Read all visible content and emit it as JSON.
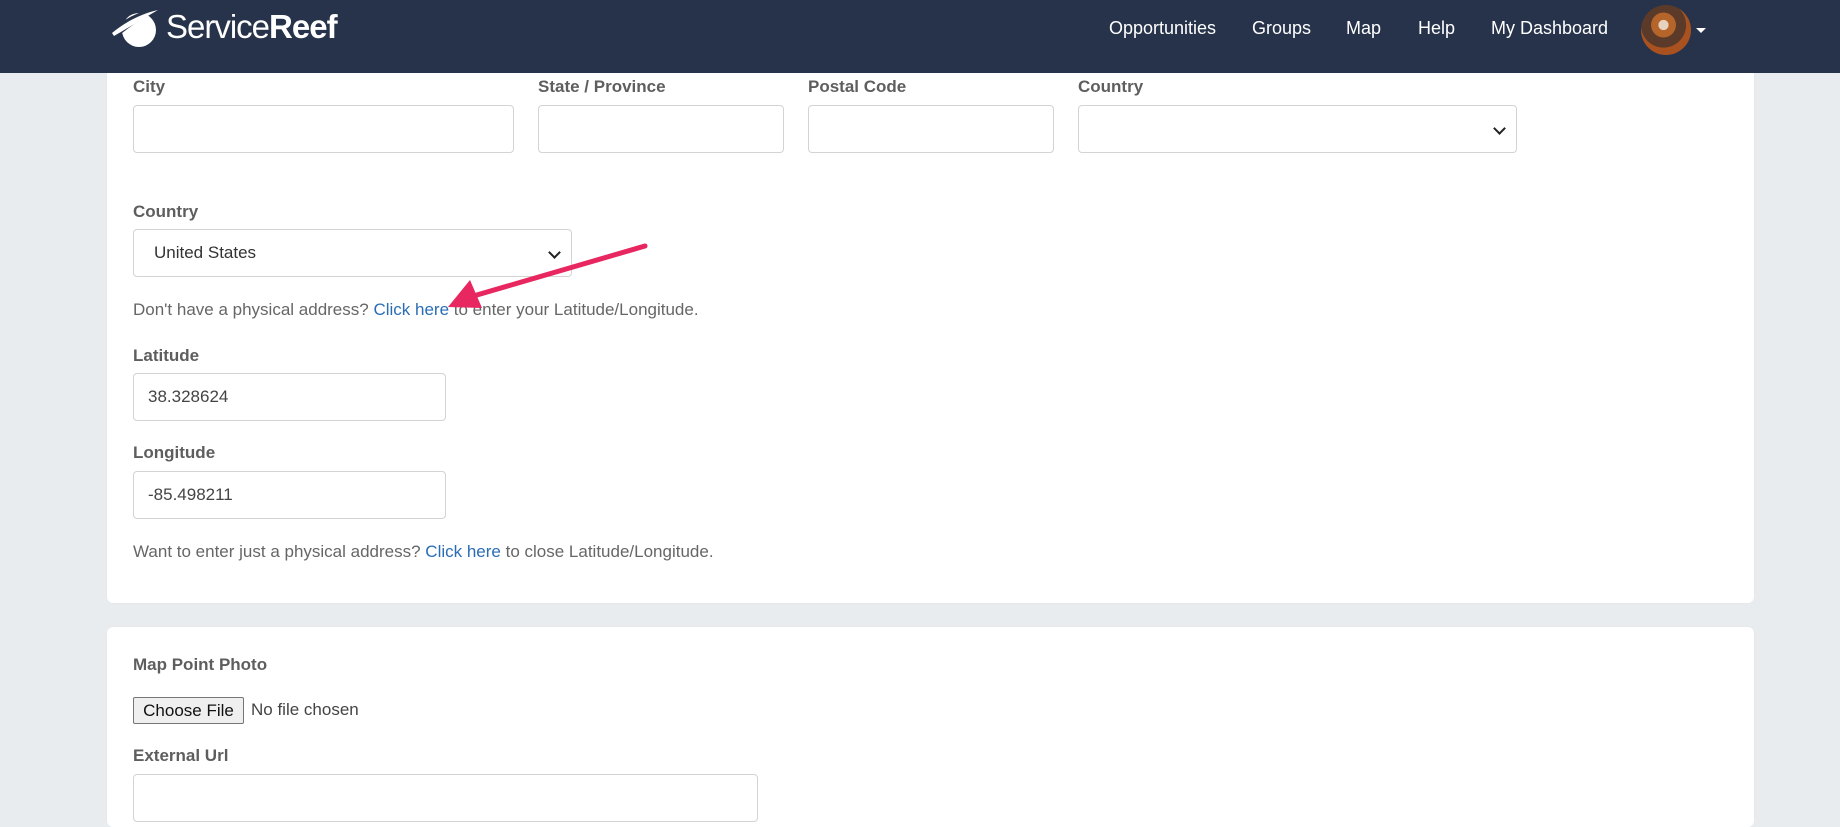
{
  "header": {
    "brand_light": "Service",
    "brand_bold": "Reef",
    "nav": [
      "Opportunities",
      "Groups",
      "Map",
      "Help",
      "My Dashboard"
    ]
  },
  "address": {
    "city_label": "City",
    "state_label": "State / Province",
    "postal_label": "Postal Code",
    "country_label": "Country",
    "city_value": "",
    "state_value": "",
    "postal_value": "",
    "country_value": ""
  },
  "location": {
    "country_label": "Country",
    "country_value": "United States",
    "no_address_prefix": "Don't have a physical address? ",
    "no_address_link": "Click here",
    "no_address_suffix": " to enter your Latitude/Longitude.",
    "latitude_label": "Latitude",
    "latitude_value": "38.328624",
    "longitude_label": "Longitude",
    "longitude_value": "-85.498211",
    "physical_prefix": "Want to enter just a physical address? ",
    "physical_link": "Click here",
    "physical_suffix": " to close Latitude/Longitude."
  },
  "media": {
    "photo_label": "Map Point Photo",
    "choose_file": "Choose File",
    "no_file": "No file chosen",
    "external_url_label": "External Url",
    "external_url_value": ""
  },
  "colors": {
    "nav_bg": "#26334a",
    "link": "#2a6db5",
    "arrow": "#e8265f",
    "page_bg": "#e9ecef"
  }
}
